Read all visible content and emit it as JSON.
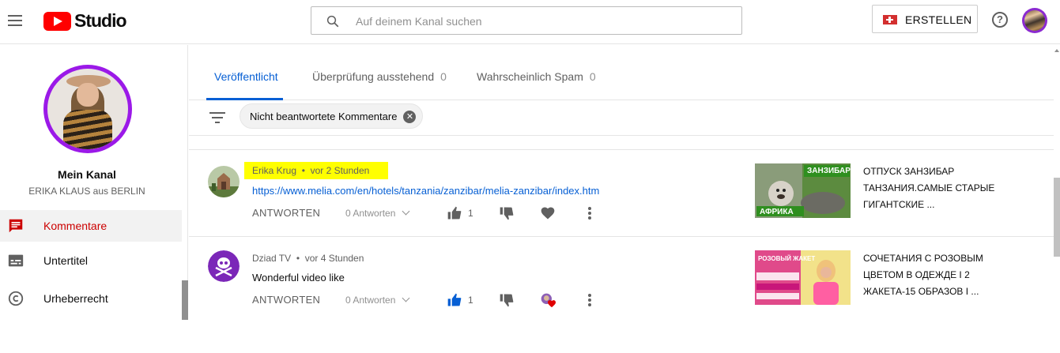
{
  "app": {
    "logo_text": "Studio"
  },
  "search": {
    "placeholder": "Auf deinem Kanal suchen"
  },
  "header": {
    "create_label": "ERSTELLEN",
    "help_label": "?"
  },
  "sidebar": {
    "channel_title": "Mein Kanal",
    "channel_name": "ERIKA KLAUS aus BERLIN",
    "items": [
      {
        "label": "Kommentare",
        "icon": "comment-icon",
        "active": true
      },
      {
        "label": "Untertitel",
        "icon": "subtitles-icon",
        "active": false
      },
      {
        "label": "Urheberrecht",
        "icon": "copyright-icon",
        "active": false
      }
    ]
  },
  "tabs": [
    {
      "label": "Veröffentlicht",
      "count": "",
      "active": true
    },
    {
      "label": "Überprüfung ausstehend",
      "count": "0",
      "active": false
    },
    {
      "label": "Wahrscheinlich Spam",
      "count": "0",
      "active": false
    }
  ],
  "filter": {
    "chip_label": "Nicht beantwortete Kommentare",
    "chip_close": "✕"
  },
  "comments": [
    {
      "author": "Erika Krug",
      "separator": "•",
      "time": "vor 2 Stunden",
      "text": "https://www.melia.com/en/hotels/tanzania/zanzibar/melia-zanzibar/index.htm",
      "reply_label": "ANTWORTEN",
      "replies_label": "0 Antworten",
      "likes": "1",
      "video_title": "ОТПУСК ЗАНЗИБАР ТАНЗАНИЯ.САМЫЕ СТАРЫЕ ГИГАНТСКИЕ ...",
      "thumb_top": "ЗАНЗИБАР",
      "thumb_bottom": "АФРИКА"
    },
    {
      "author": "Dziad TV",
      "separator": "•",
      "time": "vor 4 Stunden",
      "text": "Wonderful video like",
      "reply_label": "ANTWORTEN",
      "replies_label": "0 Antworten",
      "likes": "1",
      "video_title": "СОЧЕТАНИЯ С РОЗОВЫМ ЦВЕТОМ В ОДЕЖДЕ I 2 ЖАКЕТА-15 ОБРАЗОВ I ...",
      "thumb_top": "РОЗОВЫЙ ЖАКЕТ"
    }
  ],
  "colors": {
    "accent": "#065fd4",
    "active_nav": "#cc0000",
    "highlight": "#ffff00",
    "brand": "#ff0000"
  }
}
